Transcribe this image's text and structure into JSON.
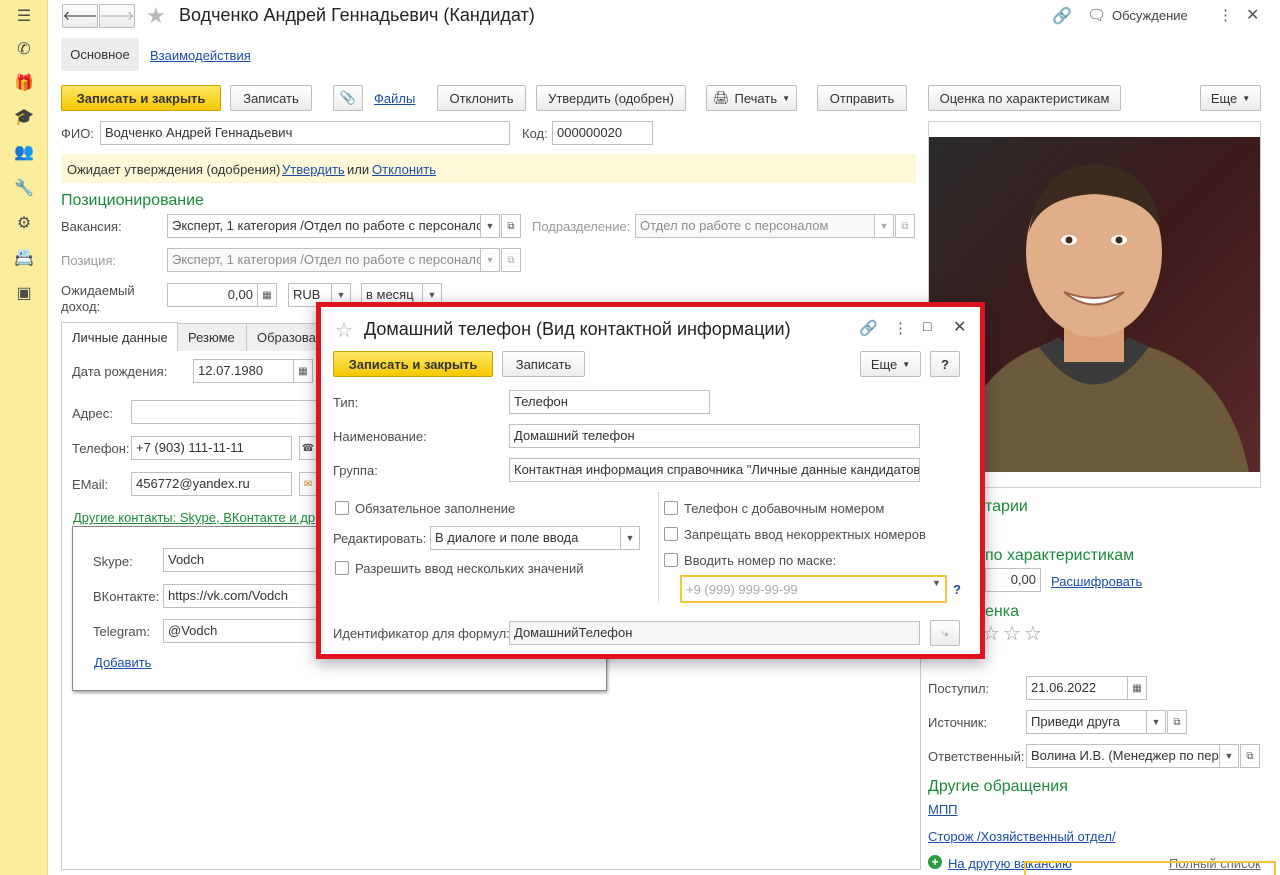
{
  "sidebar": {
    "items": [
      "menu-icon",
      "phone-icon",
      "gift-icon",
      "graduation-icon",
      "users-icon",
      "wrench-icon",
      "gear-icon",
      "card-icon",
      "app-icon"
    ]
  },
  "header": {
    "title": "Водченко Андрей Геннадьевич (Кандидат)",
    "discussion_label": "Обсуждение"
  },
  "nav_tabs": {
    "main": "Основное",
    "interactions": "Взаимодействия"
  },
  "toolbar": {
    "save_close": "Записать и закрыть",
    "save": "Записать",
    "files": "Файлы",
    "reject": "Отклонить",
    "approve": "Утвердить (одобрен)",
    "print": "Печать",
    "send": "Отправить",
    "assess": "Оценка по характеристикам",
    "more": "Еще"
  },
  "form": {
    "fio_label": "ФИО:",
    "fio_value": "Водченко Андрей Геннадьевич",
    "code_label": "Код:",
    "code_value": "000000020",
    "notice_text": "Ожидает утверждения (одобрения)",
    "notice_approve": "Утвердить",
    "notice_or": "или",
    "notice_reject": "Отклонить",
    "positioning_title": "Позиционирование",
    "vacancy_label": "Вакансия:",
    "vacancy_value": "Эксперт, 1 категория /Отдел по работе с персонало",
    "subdivision_label": "Подразделение:",
    "subdivision_value": "Отдел по работе с персоналом",
    "position_label": "Позиция:",
    "position_value": "Эксперт, 1 категория /Отдел по работе с персонало",
    "income_label_1": "Ожидаемый",
    "income_label_2": "доход:",
    "income_value": "0,00",
    "currency": "RUB",
    "period": "в месяц"
  },
  "inner_tabs": [
    "Личные данные",
    "Резюме",
    "Образова"
  ],
  "personal": {
    "birth_label": "Дата рождения:",
    "birth_value": "12.07.1980",
    "address_label": "Адрес:",
    "address_value": "",
    "phone_label": "Телефон:",
    "phone_value": "+7 (903) 111-11-11",
    "email_label": "EMail:",
    "email_value": "456772@yandex.ru",
    "other_contacts": "Другие контакты: Skype, ВКонтакте и др",
    "skype_label": "Skype:",
    "skype_value": "Vodch",
    "vk_label": "ВКонтакте:",
    "vk_value": "https://vk.com/Vodch",
    "telegram_label": "Telegram:",
    "telegram_value": "@Vodch",
    "add_link": "Добавить"
  },
  "right_panel": {
    "comments": "тарии",
    "assess_title": "по характеристикам",
    "assess_value": "0,00",
    "decode": "Расшифровать",
    "rating_title": "енка",
    "received_label": "Поступил:",
    "received_value": "21.06.2022",
    "source_label": "Источник:",
    "source_value": "Приведи друга",
    "responsible_label": "Ответственный:",
    "responsible_value": "Волина И.В. (Менеджер по пер",
    "other_requests": "Другие обращения",
    "mpp": "МПП",
    "guard": "Сторож /Хозяйственный отдел/",
    "other_vacancy": "На другую вакансию",
    "full_list": "Полный список"
  },
  "dialog": {
    "title": "Домашний телефон (Вид контактной информации)",
    "save_close": "Записать и закрыть",
    "save": "Записать",
    "more": "Еще",
    "help": "?",
    "type_label": "Тип:",
    "type_value": "Телефон",
    "name_label": "Наименование:",
    "name_value": "Домашний телефон",
    "group_label": "Группа:",
    "group_value": "Контактная информация справочника \"Личные данные кандидатов\"",
    "required_label": "Обязательное заполнение",
    "edit_label": "Редактировать:",
    "edit_value": "В диалоге и поле ввода",
    "multiple_label": "Разрешить ввод нескольких значений",
    "ext_phone_label": "Телефон с добавочным номером",
    "forbid_label": "Запрещать ввод некорректных номеров",
    "mask_label": "Вводить номер по маске:",
    "mask_placeholder": "+9 (999) 999-99-99",
    "mask_help": "?",
    "formula_label": "Идентификатор для формул:",
    "formula_value": "ДомашнийТелефон"
  },
  "colors": {
    "sidebar_bg": "#fbed9e",
    "accent_yellow": "#f5c800",
    "dialog_border": "#e0141e",
    "link": "#1a4ea8",
    "section_green": "#1b8a3a"
  }
}
